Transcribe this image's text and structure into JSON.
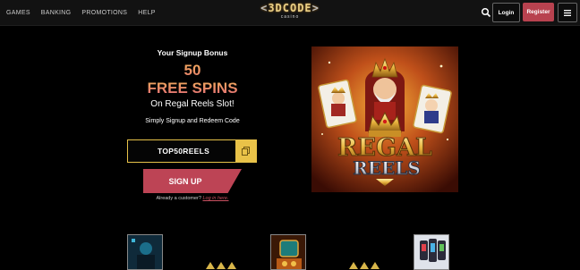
{
  "nav": {
    "items": [
      "GAMES",
      "BANKING",
      "PROMOTIONS",
      "HELP"
    ]
  },
  "logo": {
    "brand": "3DCODE",
    "left_bracket": "<",
    "right_bracket": ">",
    "subtitle": "casino"
  },
  "header": {
    "login_label": "Login",
    "register_label": "Register",
    "search_icon": "search-icon",
    "menu_icon": "hamburger-icon"
  },
  "promo": {
    "heading": "Your Signup Bonus",
    "amount": "50",
    "spins": "FREE SPINS",
    "slot": "On Regal Reels Slot!",
    "instruction": "Simply Signup and Redeem Code",
    "code": "TOP50REELS",
    "copy_icon": "copy-icon",
    "cta": "SIGN UP",
    "already_text": "Already a customer?",
    "login_link": "Log in here."
  },
  "game": {
    "title_line1": "REGAL",
    "title_line2": "REELS"
  },
  "colors": {
    "accent_red": "#bd4455",
    "gold": "#e9c248",
    "header_bg": "#121212"
  }
}
